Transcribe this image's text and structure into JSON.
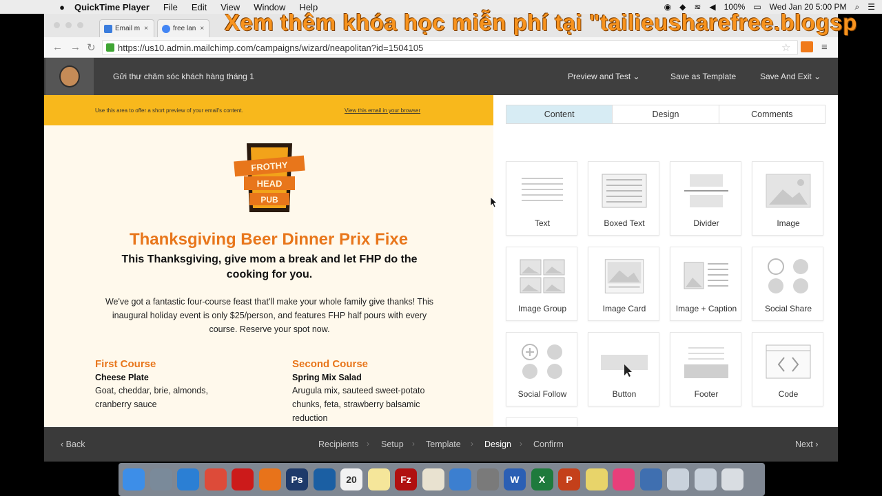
{
  "menubar": {
    "app": "QuickTime Player",
    "items": [
      "File",
      "Edit",
      "View",
      "Window",
      "Help"
    ],
    "battery": "100%",
    "clock": "Wed Jan 20  5:00 PM"
  },
  "watermark": "Xem thêm khóa học miễn phí tại \"tailieusharefree.blogsp",
  "browser": {
    "tabs": [
      {
        "label": "Email m",
        "color": "#3b7ddd"
      },
      {
        "label": "free lan",
        "color": "#4285f4"
      }
    ],
    "url": "https://us10.admin.mailchimp.com/campaigns/wizard/neapolitan?id=1504105"
  },
  "mailchimp": {
    "campaign_name": "Gửi thư chăm sóc khách hàng tháng 1",
    "preview_and_test": "Preview and Test",
    "save_as_template": "Save as Template",
    "save_and_exit": "Save And Exit"
  },
  "email": {
    "preheader_left": "Use this area to offer a short preview of your email's content.",
    "preheader_right": "View this email in your browser",
    "logo_lines": [
      "FROTHY",
      "HEAD",
      "PUB"
    ],
    "headline": "Thanksgiving Beer Dinner Prix Fixe",
    "subhead": "This Thanksgiving, give mom a break and let FHP do the cooking for you.",
    "body": "We've got a fantastic four-course feast that'll make your whole family give thanks! This inaugural holiday event is only $25/person, and features FHP half pours with every course. Reserve your spot now.",
    "courses": [
      {
        "title": "First Course",
        "name": "Cheese Plate",
        "desc": "Goat, cheddar, brie, almonds, cranberry sauce"
      },
      {
        "title": "Second Course",
        "name": "Spring Mix Salad",
        "desc": "Arugula mix, sauteed sweet-potato chunks, feta, strawberry balsamic reduction"
      }
    ]
  },
  "panel": {
    "tabs": [
      "Content",
      "Design",
      "Comments"
    ],
    "blocks": [
      "Text",
      "Boxed Text",
      "Divider",
      "Image",
      "Image Group",
      "Image Card",
      "Image + Caption",
      "Social Share",
      "Social Follow",
      "Button",
      "Footer",
      "Code"
    ]
  },
  "wizard": {
    "back": "Back",
    "steps": [
      "Recipients",
      "Setup",
      "Template",
      "Design",
      "Confirm"
    ],
    "active": "Design",
    "next": "Next"
  },
  "dock": {
    "apps": [
      {
        "name": "finder-icon",
        "color": "#3d8ee8",
        "glyph": ""
      },
      {
        "name": "launchpad-icon",
        "color": "#7a8a9a",
        "glyph": ""
      },
      {
        "name": "safari-icon",
        "color": "#2b7fd4",
        "glyph": ""
      },
      {
        "name": "chrome-icon",
        "color": "#dd4b39",
        "glyph": ""
      },
      {
        "name": "opera-icon",
        "color": "#cc1a1a",
        "glyph": ""
      },
      {
        "name": "firefox-icon",
        "color": "#e8731a",
        "glyph": ""
      },
      {
        "name": "photoshop-icon",
        "color": "#1e3a6a",
        "glyph": "Ps"
      },
      {
        "name": "app-icon",
        "color": "#1b5fa3",
        "glyph": ""
      },
      {
        "name": "calendar-icon",
        "color": "#f2f2f2",
        "glyph": "20"
      },
      {
        "name": "notes-icon",
        "color": "#f5e69a",
        "glyph": ""
      },
      {
        "name": "filezilla-icon",
        "color": "#b01010",
        "glyph": "Fz"
      },
      {
        "name": "photos-icon",
        "color": "#e9e2d0",
        "glyph": ""
      },
      {
        "name": "preview-icon",
        "color": "#3c7fd0",
        "glyph": ""
      },
      {
        "name": "system-preferences-icon",
        "color": "#7a7a7a",
        "glyph": ""
      },
      {
        "name": "word-icon",
        "color": "#2b5fb4",
        "glyph": "W"
      },
      {
        "name": "excel-icon",
        "color": "#1e7a3c",
        "glyph": "X"
      },
      {
        "name": "powerpoint-icon",
        "color": "#c4401a",
        "glyph": "P"
      },
      {
        "name": "stickies-icon",
        "color": "#e8d46a",
        "glyph": ""
      },
      {
        "name": "itunes-icon",
        "color": "#e83f7a",
        "glyph": ""
      },
      {
        "name": "quicktime-icon",
        "color": "#3f6fb0",
        "glyph": ""
      },
      {
        "name": "downloads-icon",
        "color": "#c9d2dc",
        "glyph": ""
      },
      {
        "name": "documents-icon",
        "color": "#c9d2dc",
        "glyph": ""
      },
      {
        "name": "trash-icon",
        "color": "#d9dde2",
        "glyph": ""
      }
    ]
  }
}
